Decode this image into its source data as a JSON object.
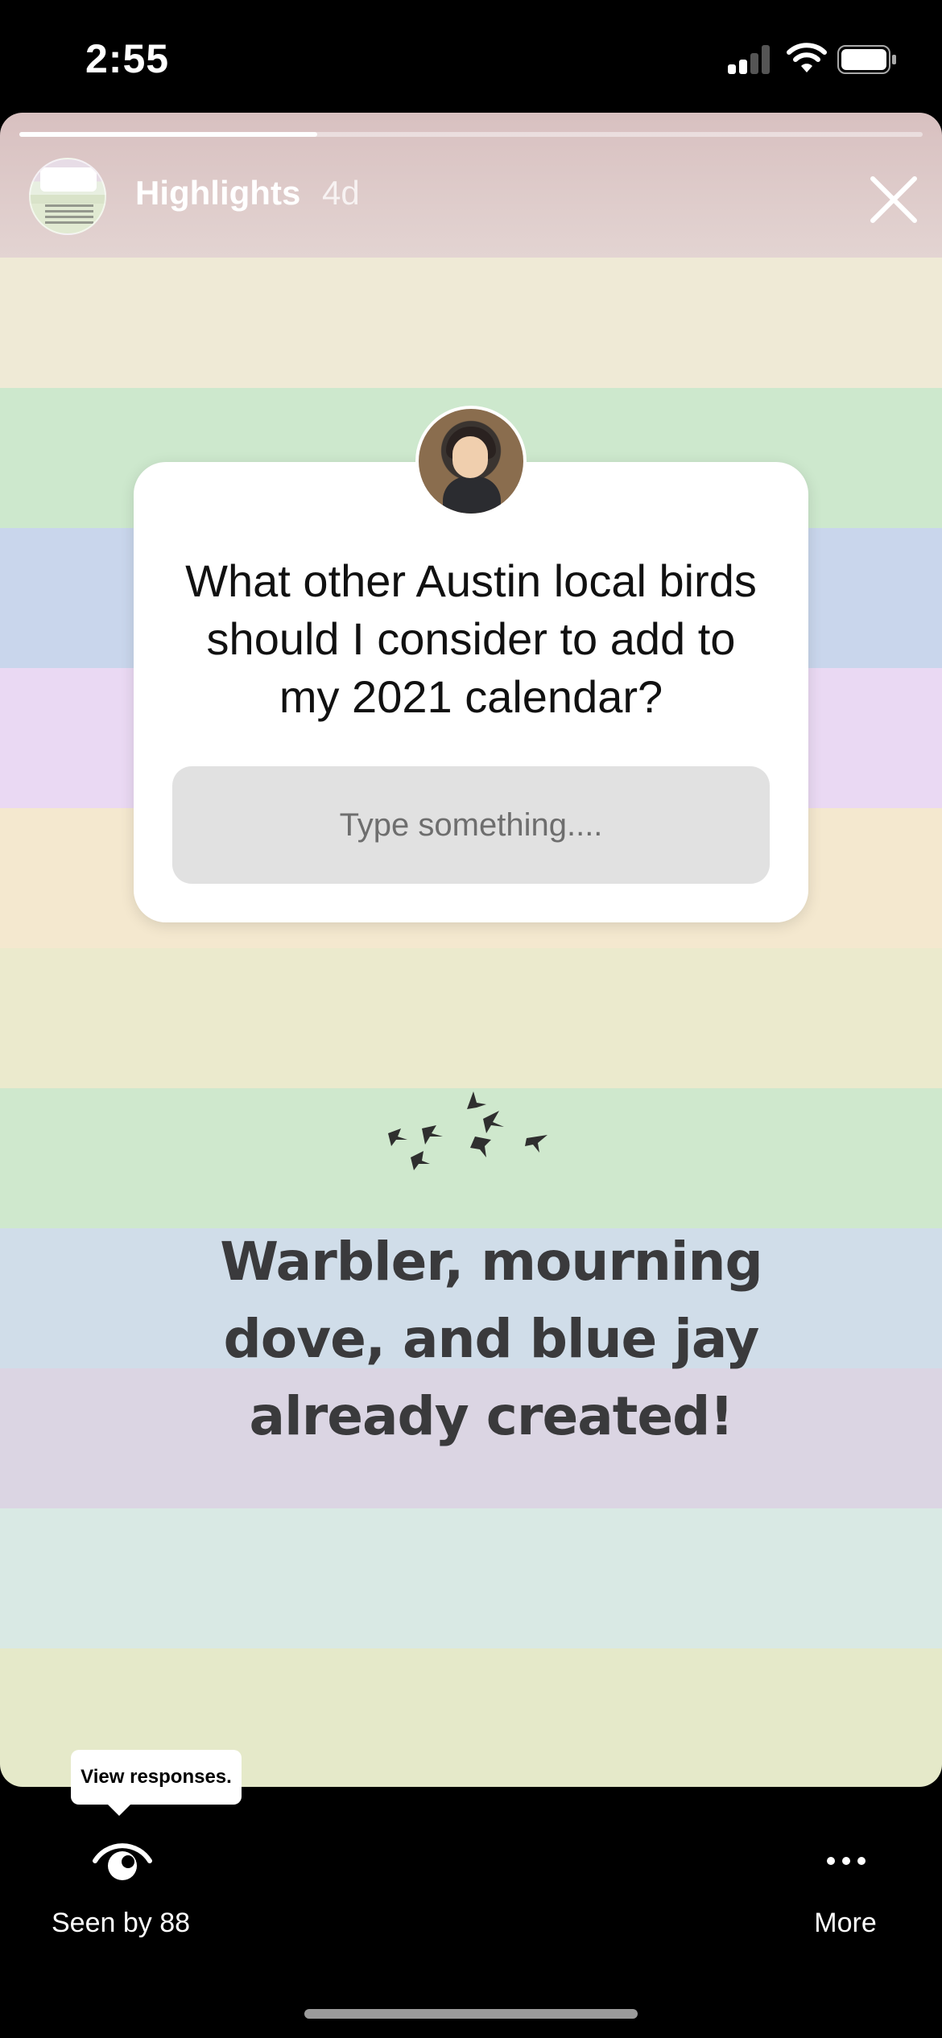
{
  "status_bar": {
    "time": "2:55",
    "icons": [
      "cellular-signal-icon",
      "wifi-icon",
      "battery-icon"
    ]
  },
  "story": {
    "title": "Highlights",
    "age": "4d",
    "progress": 0.33,
    "background_stripes": [
      "#d9c2c2",
      "#efead6",
      "#cde8cd",
      "#c9d6ec",
      "#ead9f3",
      "#f4e8cf",
      "#ebeacd",
      "#cfe8cd",
      "#d0dde9",
      "#dbd5e3",
      "#d9e9e4",
      "#e5e9c9"
    ],
    "question": {
      "text": "What other Austin local birds should I consider to add to my 2021 calendar?",
      "placeholder": "Type something...."
    },
    "caption": "Warbler, mourning dove, and blue jay already created!"
  },
  "bottom_bar": {
    "tooltip": "View responses.",
    "seen_label": "Seen by 88",
    "more_label": "More"
  }
}
